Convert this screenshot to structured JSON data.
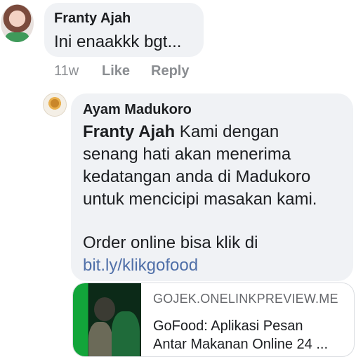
{
  "comment1": {
    "author": "Franty Ajah",
    "text": "Ini enaakkk bgt...",
    "time": "11w",
    "like_label": "Like",
    "reply_label": "Reply"
  },
  "reply1": {
    "author": "Ayam Madukoro",
    "mention": "Franty Ajah",
    "lines": [
      " Kami dengan",
      "senang hati akan menerima",
      "kedatangan anda di Madukoro",
      "untuk mencicipi masakan kami."
    ],
    "order_text": "Order online bisa klik di",
    "link": "bit.ly/klikgofood"
  },
  "link_preview": {
    "domain": "GOJEK.ONELINKPREVIEW.ME",
    "title_line1": "GoFood: Aplikasi Pesan",
    "title_line2": "Antar Makanan Online 24 ..."
  }
}
